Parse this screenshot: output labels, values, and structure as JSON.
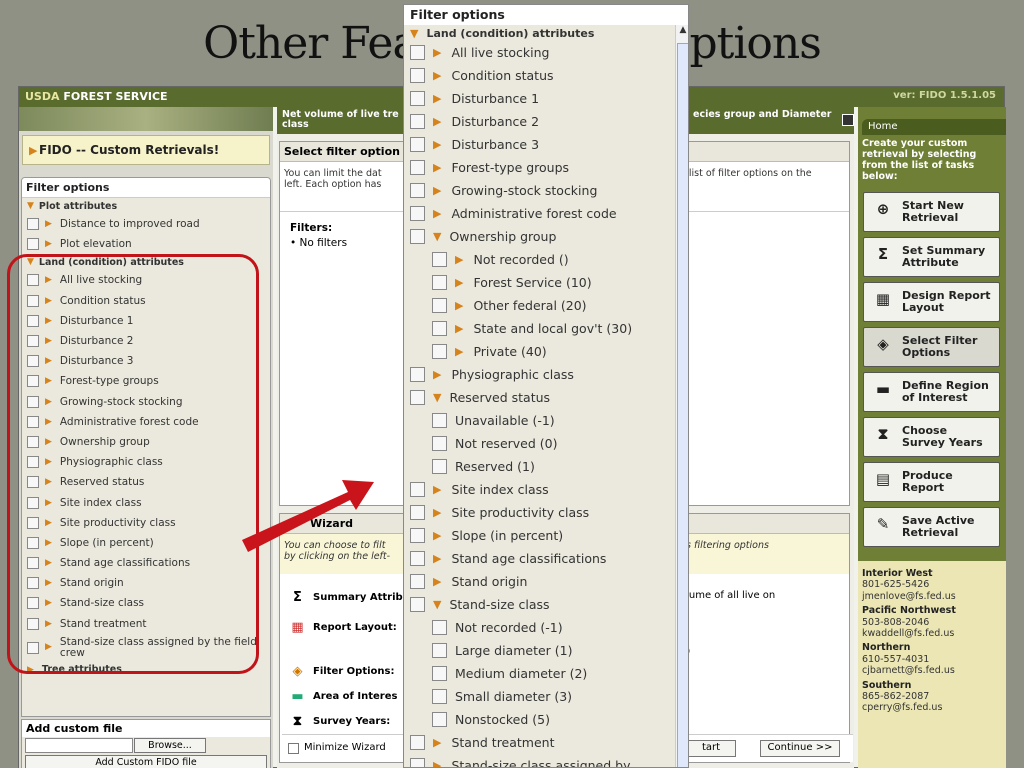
{
  "slide": {
    "title": "Other Feature: Filter options"
  },
  "app": {
    "brand_usda": "USDA",
    "brand_name": "FOREST SERVICE",
    "version": "ver: FIDO 1.5.1.05"
  },
  "left": {
    "header": "FIDO -- Custom Retrievals!",
    "filter_title": "Filter options",
    "plot_group": "Plot attributes",
    "plot_items": [
      "Distance to improved road",
      "Plot elevation"
    ],
    "land_group": "Land (condition) attributes",
    "land_items": [
      "All live stocking",
      "Condition status",
      "Disturbance 1",
      "Disturbance 2",
      "Disturbance 3",
      "Forest-type groups",
      "Growing-stock stocking",
      "Administrative forest code",
      "Ownership group",
      "Physiographic class",
      "Reserved status",
      "Site index class",
      "Site productivity class",
      "Slope (in percent)",
      "Stand age classifications",
      "Stand origin",
      "Stand-size class",
      "Stand treatment",
      "Stand-size class assigned by the field crew"
    ],
    "tree_group": "Tree attributes",
    "custom_title": "Add custom file",
    "browse": "Browse...",
    "add_custom": "Add Custom FIDO file"
  },
  "center": {
    "header_left": "Net volume of live tre",
    "header_right": "ecies group and Diameter",
    "header_line2": "class",
    "select_title": "Select filter option",
    "desc_left": "You can limit the dat",
    "desc_left2": "left. Each option has",
    "desc_right": "e list of filter options on the",
    "desc_right2": "n.",
    "filters_label": "Filters:",
    "filters_value": "No filters",
    "wizard_title": "Wizard",
    "wizard_desc1": "You can choose to filt",
    "wizard_desc1r": "us filtering options",
    "wizard_desc2": "by clicking on the left-",
    "rows": [
      "Summary Attrib",
      "Report Layout:",
      "Filter Options:",
      "Area of Interes",
      "Survey Years:"
    ],
    "summary_right": "olume of all live on",
    "layout_right": "d)",
    "minimize": "Minimize Wizard",
    "start": "tart",
    "continue": "Continue >>"
  },
  "right": {
    "home": "Home",
    "desc": "Create your custom retrieval by selecting from the list of tasks below:",
    "buttons": [
      {
        "label1": "Start New",
        "label2": "Retrieval",
        "icon": "target-icon"
      },
      {
        "label1": "Set Summary",
        "label2": "Attribute",
        "icon": "sigma-icon"
      },
      {
        "label1": "Design Report",
        "label2": "Layout",
        "icon": "grid-icon"
      },
      {
        "label1": "Select Filter",
        "label2": "Options",
        "icon": "filter-icon"
      },
      {
        "label1": "Define Region",
        "label2": "of Interest",
        "icon": "map-icon"
      },
      {
        "label1": "Choose",
        "label2": "Survey Years",
        "icon": "hourglass-icon"
      },
      {
        "label1": "Produce",
        "label2": "Report",
        "icon": "report-icon"
      },
      {
        "label1": "Save Active",
        "label2": "Retrieval",
        "icon": "save-icon"
      }
    ],
    "contacts": [
      {
        "region": "Interior West",
        "phone": "801-625-5426",
        "email": "jmenlove@fs.fed.us"
      },
      {
        "region": "Pacific Northwest",
        "phone": "503-808-2046",
        "email": "kwaddell@fs.fed.us"
      },
      {
        "region": "Northern",
        "phone": "610-557-4031",
        "email": "cjbarnett@fs.fed.us"
      },
      {
        "region": "Southern",
        "phone": "865-862-2087",
        "email": "cperry@fs.fed.us"
      }
    ]
  },
  "popup": {
    "title": "Filter options",
    "group": "Land (condition) attributes",
    "items_a": [
      "All live stocking",
      "Condition status",
      "Disturbance 1",
      "Disturbance 2",
      "Disturbance 3",
      "Forest-type groups",
      "Growing-stock stocking",
      "Administrative forest code"
    ],
    "ownership": "Ownership group",
    "ownership_items": [
      "Not recorded ()",
      "Forest Service (10)",
      "Other federal (20)",
      "State and local gov't (30)",
      "Private (40)"
    ],
    "physio": "Physiographic class",
    "reserved": "Reserved status",
    "reserved_items": [
      "Unavailable (-1)",
      "Not reserved (0)",
      "Reserved (1)"
    ],
    "items_b": [
      "Site index class",
      "Site productivity class",
      "Slope (in percent)",
      "Stand age classifications",
      "Stand origin"
    ],
    "standsize": "Stand-size class",
    "standsize_items": [
      "Not recorded (-1)",
      "Large diameter (1)",
      "Medium diameter (2)",
      "Small diameter (3)",
      "Nonstocked (5)"
    ],
    "treatment": "Stand treatment",
    "last": "Stand-size class assigned by"
  }
}
